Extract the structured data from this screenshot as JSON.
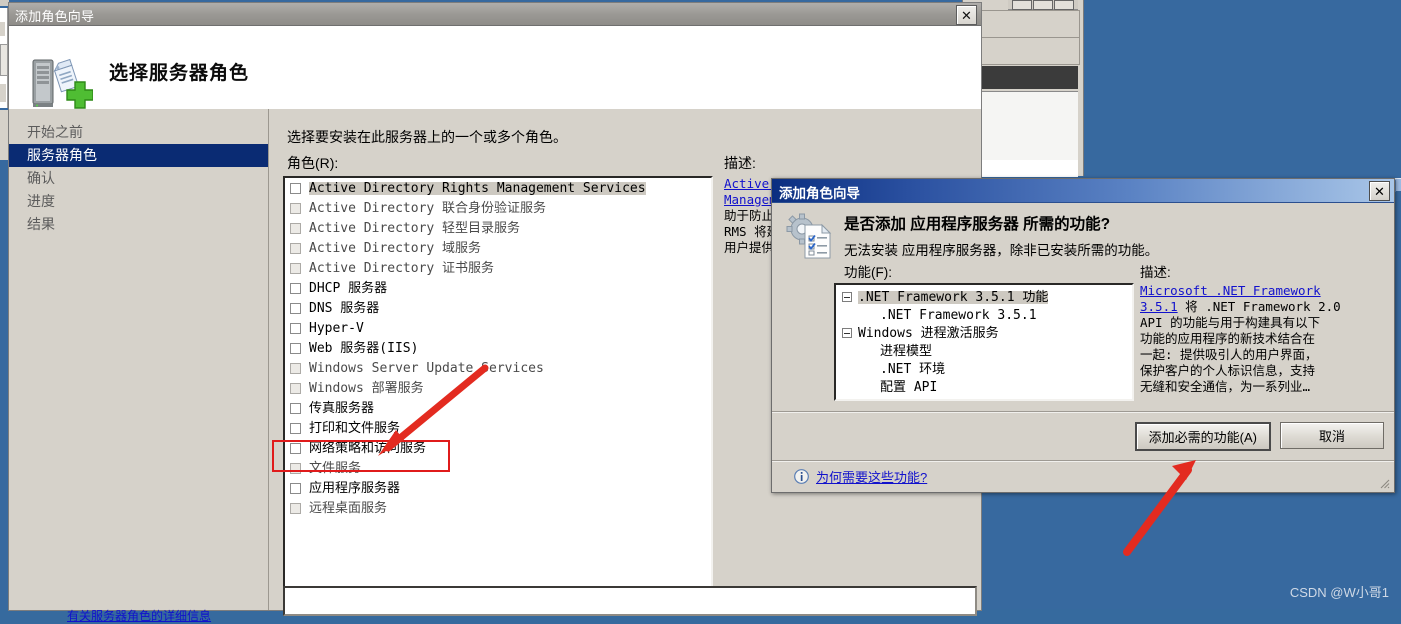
{
  "wizard": {
    "title": "添加角色向导",
    "close_label": "✕",
    "header_title": "选择服务器角色",
    "header_icon": "server-add-icon",
    "sidebar": {
      "items": [
        {
          "label": "开始之前",
          "selected": false
        },
        {
          "label": "服务器角色",
          "selected": true
        },
        {
          "label": "确认",
          "selected": false
        },
        {
          "label": "进度",
          "selected": false
        },
        {
          "label": "结果",
          "selected": false
        }
      ]
    },
    "content": {
      "intro": "选择要安装在此服务器上的一个或多个角色。",
      "roles_label": "角色(R):",
      "roles": [
        {
          "label": "Active Directory Rights Management Services",
          "checked": false,
          "disabled": false,
          "highlighted": true
        },
        {
          "label": "Active Directory 联合身份验证服务",
          "checked": false,
          "disabled": true,
          "highlighted": false
        },
        {
          "label": "Active Directory 轻型目录服务",
          "checked": false,
          "disabled": true,
          "highlighted": false
        },
        {
          "label": "Active Directory 域服务",
          "checked": false,
          "disabled": true,
          "highlighted": false
        },
        {
          "label": "Active Directory 证书服务",
          "checked": false,
          "disabled": true,
          "highlighted": false
        },
        {
          "label": "DHCP 服务器",
          "checked": false,
          "disabled": false,
          "highlighted": false
        },
        {
          "label": "DNS 服务器",
          "checked": false,
          "disabled": false,
          "highlighted": false
        },
        {
          "label": "Hyper-V",
          "checked": false,
          "disabled": false,
          "highlighted": false
        },
        {
          "label": "Web 服务器(IIS)",
          "checked": false,
          "disabled": false,
          "highlighted": false
        },
        {
          "label": "Windows Server Update Services",
          "checked": false,
          "disabled": true,
          "highlighted": false
        },
        {
          "label": "Windows 部署服务",
          "checked": false,
          "disabled": true,
          "highlighted": false
        },
        {
          "label": "传真服务器",
          "checked": false,
          "disabled": false,
          "highlighted": false
        },
        {
          "label": "打印和文件服务",
          "checked": false,
          "disabled": false,
          "highlighted": false
        },
        {
          "label": "网络策略和访问服务",
          "checked": false,
          "disabled": false,
          "highlighted": false
        },
        {
          "label": "文件服务",
          "checked": false,
          "disabled": true,
          "highlighted": false
        },
        {
          "label": "应用程序服务器",
          "checked": false,
          "disabled": false,
          "highlighted": false
        },
        {
          "label": "远程桌面服务",
          "checked": false,
          "disabled": true,
          "highlighted": false
        }
      ],
      "description_label": "描述:",
      "description_lines": [
        "Active Directory Rights",
        "Management Services",
        "助于防止",
        "RMS 将建",
        "用户提供"
      ],
      "description_link_lines": [
        0,
        1
      ]
    },
    "bottom_link": "有关服务器角色的详细信息"
  },
  "dialog": {
    "title": "添加角色向导",
    "close_label": "✕",
    "icon": "gear-checklist-icon",
    "question": "是否添加 应用程序服务器 所需的功能?",
    "subtext": "无法安装 应用程序服务器，除非已安装所需的功能。",
    "features_label": "功能(F):",
    "features": [
      {
        "label": ".NET Framework 3.5.1 功能",
        "expander": true,
        "indent": false,
        "highlighted": true
      },
      {
        "label": ".NET Framework 3.5.1",
        "expander": false,
        "indent": true,
        "highlighted": false
      },
      {
        "label": "Windows 进程激活服务",
        "expander": true,
        "indent": false,
        "highlighted": false
      },
      {
        "label": "进程模型",
        "expander": false,
        "indent": true,
        "highlighted": false
      },
      {
        "label": ".NET 环境",
        "expander": false,
        "indent": true,
        "highlighted": false
      },
      {
        "label": "配置 API",
        "expander": false,
        "indent": true,
        "highlighted": false
      }
    ],
    "description_label": "描述:",
    "description_lines": [
      "Microsoft .NET Framework",
      "3.5.1 将 .NET Framework 2.0",
      "API 的功能与用于构建具有以下",
      "功能的应用程序的新技术结合在",
      "一起: 提供吸引人的用户界面，",
      "保护客户的个人标识信息，支持",
      "无缝和安全通信，为一系列业…"
    ],
    "description_link_text": "Microsoft .NET Framework 3.5.1",
    "buttons": {
      "primary": "添加必需的功能(A)",
      "cancel": "取消"
    },
    "help_icon": "info-icon",
    "help_link": "为何需要这些功能?"
  },
  "annotations": {
    "highlight_target": "应用程序服务器",
    "arrow_to_role": "arrow-pointing-to-application-server-role",
    "arrow_to_button": "arrow-pointing-to-add-required-features-button",
    "color": "#e01b1b"
  },
  "watermark": "CSDN @W小哥1",
  "colors": {
    "desktop": "#37699f",
    "window_face": "#d6d2ca",
    "selection": "#0a2b73",
    "dialog_title_start": "#0b2e80",
    "link": "#1111cc",
    "annotation": "#e01b1b"
  }
}
